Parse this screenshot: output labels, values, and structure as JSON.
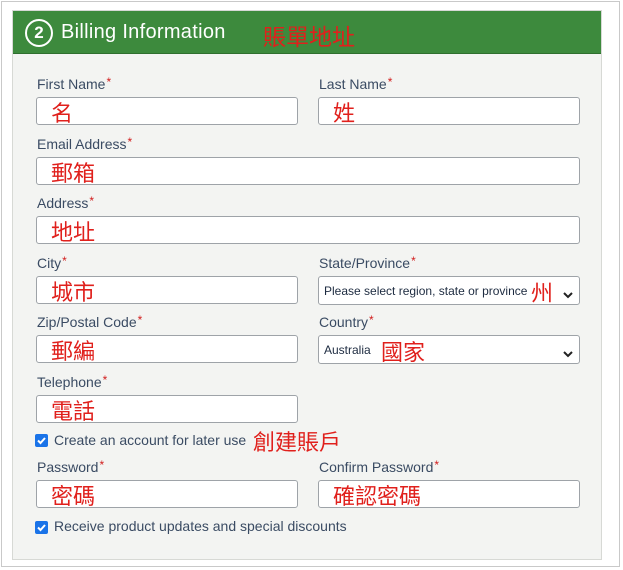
{
  "header": {
    "step_number": "2",
    "title": "Billing Information",
    "annotation": "賬單地址"
  },
  "fields": {
    "first_name": {
      "label": "First Name",
      "required": "*",
      "value": "名"
    },
    "last_name": {
      "label": "Last Name",
      "required": "*",
      "value": "姓"
    },
    "email": {
      "label": "Email Address",
      "required": "*",
      "value": "郵箱"
    },
    "address": {
      "label": "Address",
      "required": "*",
      "value": "地址"
    },
    "city": {
      "label": "City",
      "required": "*",
      "value": "城市"
    },
    "state": {
      "label": "State/Province",
      "required": "*",
      "selected": "Please select region, state or province",
      "annotation": "州"
    },
    "zip": {
      "label": "Zip/Postal Code",
      "required": "*",
      "value": "郵編"
    },
    "country": {
      "label": "Country",
      "required": "*",
      "selected": "Australia",
      "annotation": "國家"
    },
    "telephone": {
      "label": "Telephone",
      "required": "*",
      "value": "電話"
    },
    "password": {
      "label": "Password",
      "required": "*",
      "value": "密碼"
    },
    "confirm_password": {
      "label": "Confirm Password",
      "required": "*",
      "value": "確認密碼"
    }
  },
  "checkboxes": {
    "create_account": {
      "label": "Create an account for later use",
      "checked": true,
      "annotation": "創建賬戶"
    },
    "receive_updates": {
      "label": "Receive product updates and special discounts",
      "checked": true
    }
  },
  "icons": {
    "select_arrow": "chevron-down-icon",
    "checkbox_mark": "checkmark-icon"
  },
  "colors": {
    "header_bg": "#3d8a3d",
    "annotation_red": "#e0201c",
    "checkbox_blue": "#1a73e8",
    "label_text": "#3a4b63"
  }
}
